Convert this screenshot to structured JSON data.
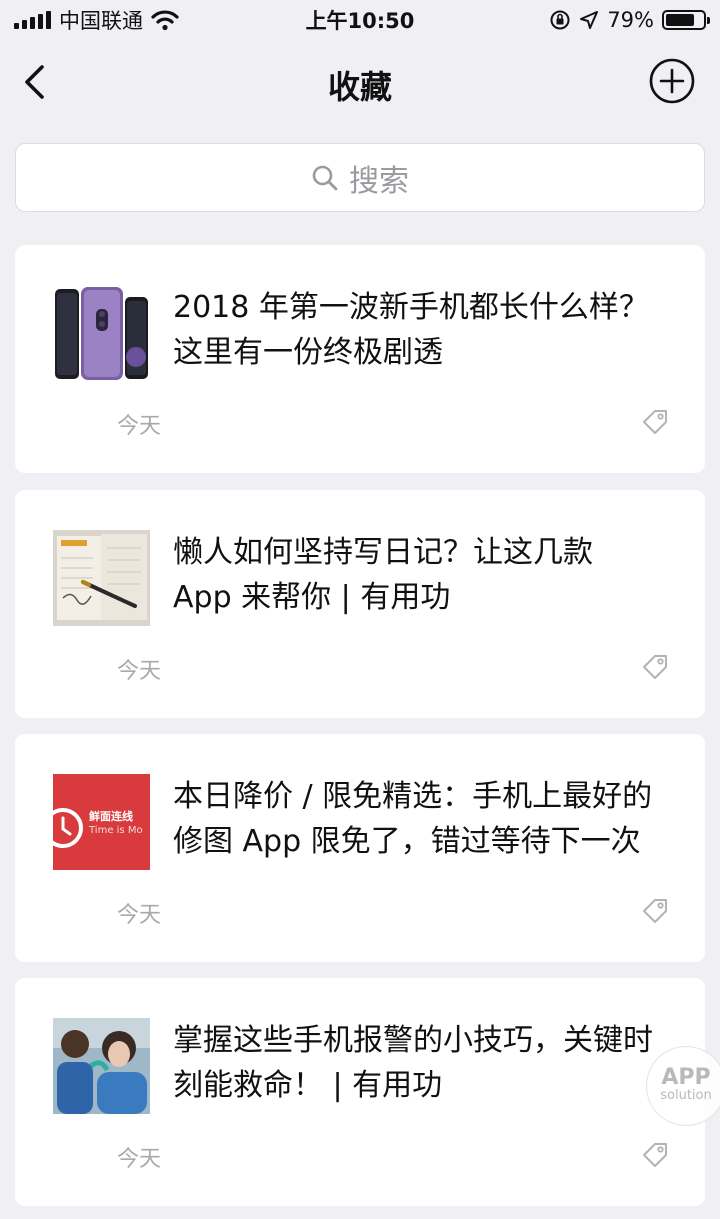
{
  "status_bar": {
    "carrier": "中国联通",
    "time": "上午10:50",
    "battery_percent": "79%",
    "battery_level": 0.79
  },
  "nav": {
    "title": "收藏"
  },
  "search": {
    "placeholder": "搜索"
  },
  "items": [
    {
      "title": "2018 年第一波新手机都长什么样？这里有一份终极剧透",
      "date": "今天"
    },
    {
      "title": "懒人如何坚持写日记？让这几款 App 来帮你 | 有用功",
      "date": "今天"
    },
    {
      "title": "本日降价 / 限免精选：手机上最好的修图 App 限免了，错过等待下一次",
      "date": "今天",
      "thumb_text": "鲜面连线",
      "thumb_subtext": "Time is Mo"
    },
    {
      "title": "掌握这些手机报警的小技巧，关键时刻能救命！ | 有用功",
      "date": "今天"
    }
  ],
  "watermark": {
    "line1": "APP",
    "line2": "solution"
  },
  "colors": {
    "background": "#efeff4",
    "card": "#ffffff",
    "secondary_text": "#a8a8ad"
  }
}
